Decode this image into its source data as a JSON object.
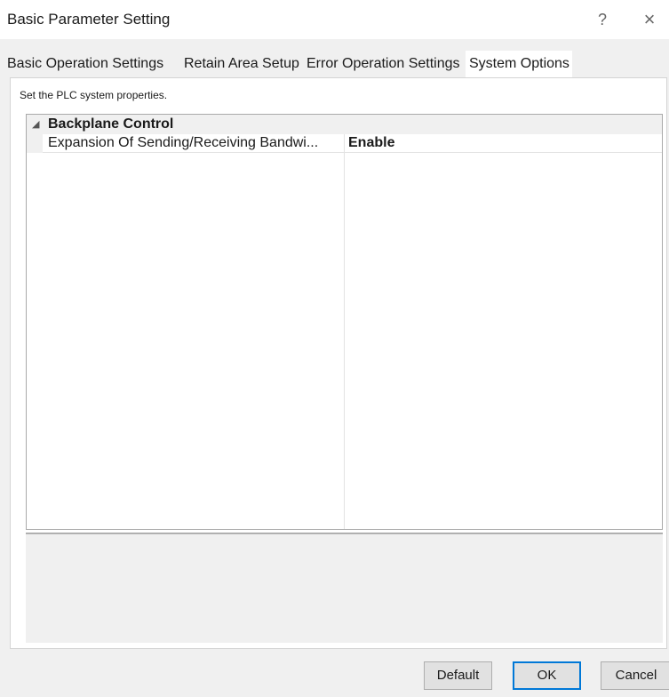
{
  "window": {
    "title": "Basic Parameter Setting",
    "help_glyph": "?",
    "close_glyph": "×"
  },
  "tabs": [
    {
      "label": "Basic Operation Settings",
      "active": false
    },
    {
      "label": "Retain Area Setup",
      "active": false
    },
    {
      "label": "Error Operation Settings",
      "active": false
    },
    {
      "label": "System Options",
      "active": true
    }
  ],
  "panel": {
    "description": "Set the PLC system properties."
  },
  "property_grid": {
    "group": {
      "expand_glyph": "◢",
      "label": "Backplane Control"
    },
    "rows": [
      {
        "name": "Expansion Of Sending/Receiving Bandwi...",
        "value": "Enable"
      }
    ]
  },
  "buttons": {
    "default_label": "Default",
    "ok_label": "OK",
    "cancel_label": "Cancel"
  },
  "colors": {
    "window_bg": "#f0f0f0",
    "active_tab_bg": "#ffffff",
    "ok_border": "#0078d7"
  }
}
